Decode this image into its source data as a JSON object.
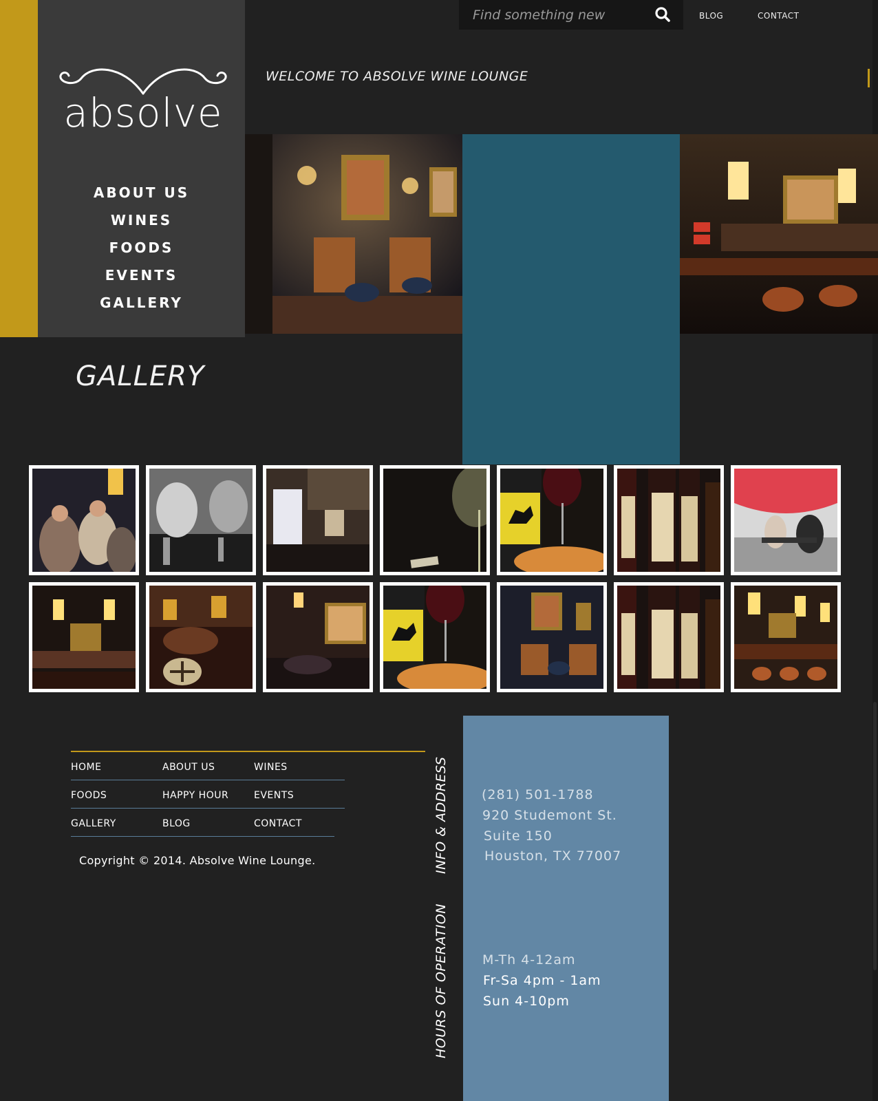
{
  "brand": {
    "logo_text": "absolve"
  },
  "main_nav": [
    "ABOUT US",
    "WINES",
    "FOODS",
    "EVENTS",
    "GALLERY"
  ],
  "search": {
    "placeholder": "Find something new",
    "icon": "search-icon"
  },
  "top_links": {
    "blog": "BLOG",
    "contact": "CONTACT"
  },
  "welcome": "WELCOME TO ABSOLVE WINE LOUNGE",
  "gallery": {
    "title": "GALLERY",
    "thumbs": [
      "crowd-at-bar-photo",
      "bw-guests-drinks-photo",
      "menu-on-table-photo",
      "wine-glass-closeup-photo",
      "wine-bottle-pizza-photo",
      "wine-bottles-labels-photo",
      "patio-red-umbrella-photo",
      "bar-with-lamps-photo",
      "lounge-sofa-photo",
      "painting-lounge-photo",
      "wine-bottle-pizza-photo",
      "lounge-portraits-photo",
      "wine-bottles-labels-photo",
      "bar-counter-photo"
    ]
  },
  "footer": {
    "nav_rows": [
      [
        "HOME",
        "ABOUT US",
        "WINES"
      ],
      [
        "FOODS",
        "HAPPY HOUR",
        "EVENTS"
      ],
      [
        "GALLERY",
        "BLOG",
        "CONTACT"
      ]
    ],
    "copyright": "Copyright © 2014. Absolve Wine Lounge.",
    "info_heading": "INFO & ADDRESS",
    "hours_heading": "HOURS OF OPERATION",
    "phone": "(281) 501-1788",
    "address_line1": "920 Studemont St.",
    "address_line2": "Suite 150",
    "address_line3": "Houston, TX 77007",
    "hours": [
      "M-Th 4-12am",
      "Fr-Sa 4pm - 1am",
      "Sun 4-10pm"
    ]
  },
  "colors": {
    "gold": "#c2991a",
    "panel": "#3a3a3a",
    "background": "#212121",
    "teal_block": "#245a6e",
    "info_blue": "#6287a5"
  }
}
